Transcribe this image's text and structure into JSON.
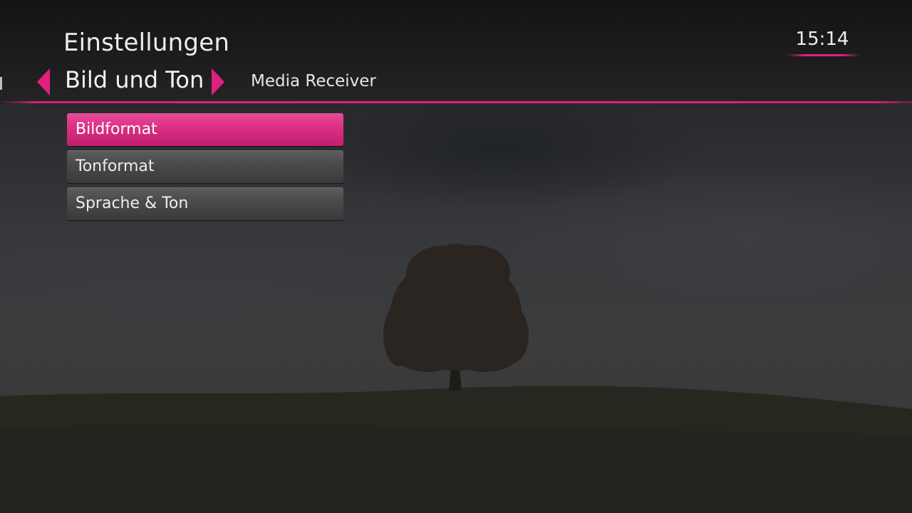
{
  "header": {
    "title": "Einstellungen",
    "clock": "15:14"
  },
  "nav": {
    "current_section": "Bild und Ton",
    "next_section": "Media Receiver",
    "prev_icon": "chevron-left-icon",
    "next_icon": "chevron-right-icon"
  },
  "menu": {
    "selected_index": 0,
    "items": [
      {
        "label": "Bildformat"
      },
      {
        "label": "Tonformat"
      },
      {
        "label": "Sprache & Ton"
      }
    ]
  },
  "colors": {
    "accent": "#e0207e",
    "menu_item": "#4a4a4a",
    "text": "#ececec"
  }
}
